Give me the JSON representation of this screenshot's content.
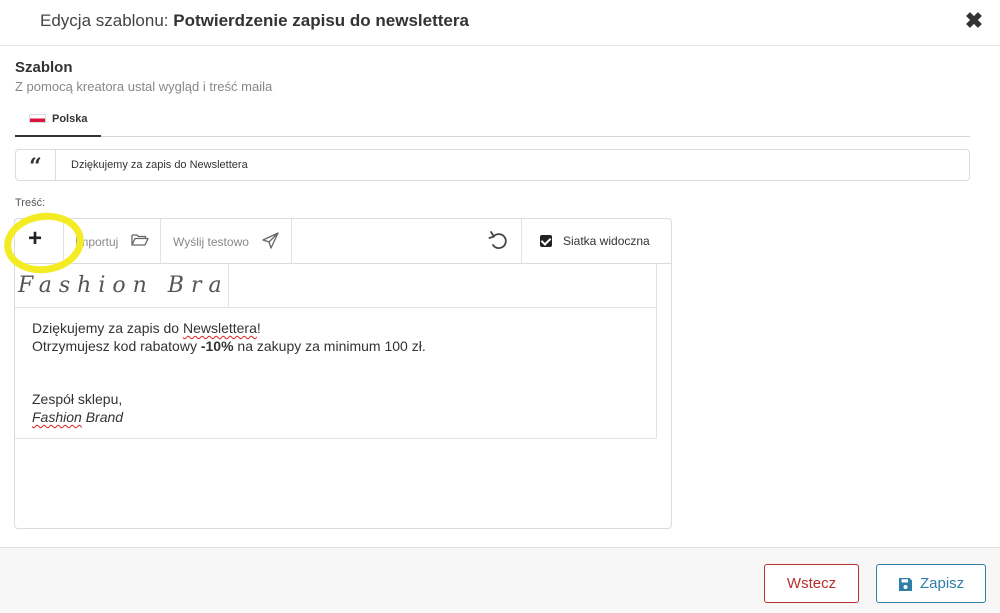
{
  "header": {
    "title_prefix": "Edycja szablonu:",
    "title_name": "Potwierdzenie zapisu do newslettera",
    "close_icon": "close-icon"
  },
  "section": {
    "title": "Szablon",
    "subtitle": "Z pomocą kreatora ustal wygląd i treść maila"
  },
  "tabs": [
    {
      "label": "Polska",
      "flag": "poland-flag-icon",
      "active": true
    }
  ],
  "subject": {
    "icon": "quote-icon",
    "value": "Dziękujemy za zapis do Newslettera"
  },
  "body_label": "Treść:",
  "toolbar": {
    "add_icon": "plus-icon",
    "import_label": "Importuj",
    "import_icon": "folder-open-icon",
    "send_test_label": "Wyślij testowo",
    "send_test_icon": "paper-plane-icon",
    "undo_icon": "undo-icon",
    "grid_label": "Siatka widoczna",
    "grid_checked": true
  },
  "canvas": {
    "logo_text": "Fashion Brand",
    "line1_pre": "Dziękujemy za zapis do ",
    "line1_word": "Newslettera",
    "line1_post": "!",
    "line2_pre": "Otrzymujesz kod rabatowy ",
    "line2_bold": "-10%",
    "line2_post": " na zakupy za minimum 100 zł.",
    "signoff": "Zespół sklepu,",
    "sig_word": "Fashion",
    "sig_rest": " Brand"
  },
  "footer": {
    "back_label": "Wstecz",
    "save_label": "Zapisz",
    "save_icon": "floppy-disk-icon"
  },
  "colors": {
    "back_accent": "#b93030",
    "save_accent": "#2d7fa8",
    "highlight": "#f3ec25"
  }
}
